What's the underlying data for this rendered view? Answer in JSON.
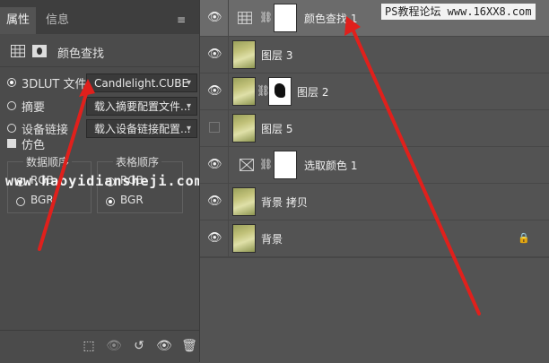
{
  "properties": {
    "tabs": [
      "属性",
      "信息"
    ],
    "header_title": "颜色查找",
    "lut_label": "3DLUT 文件",
    "lut_value": "Candlelight.CUBE",
    "abstract_label": "摘要",
    "abstract_value": "载入摘要配置文件...",
    "device_link_label": "设备链接",
    "device_link_value": "载入设备链接配置...",
    "dither_label": "仿色",
    "data_order": {
      "title": "数据顺序",
      "options": [
        "RGB",
        "BGR"
      ],
      "selected": "RGB"
    },
    "table_order": {
      "title": "表格顺序",
      "options": [
        "RGB",
        "BGR"
      ],
      "selected": "BGR"
    },
    "watermark": "www.haoyidiansheji.com"
  },
  "layers_panel": {
    "watermark": "PS教程论坛 www.16XX8.com",
    "layers": [
      {
        "name": "颜色查找 1",
        "kind": "adjustment-mask",
        "visible": true,
        "selected": true
      },
      {
        "name": "图层 3",
        "kind": "photo",
        "visible": true
      },
      {
        "name": "图层 2",
        "kind": "photo-mask",
        "visible": true
      },
      {
        "name": "图层 5",
        "kind": "photo",
        "visible": false
      },
      {
        "name": "选取颜色 1",
        "kind": "adjustment-mask",
        "visible": true
      },
      {
        "name": "背景 拷贝",
        "kind": "photo",
        "visible": true
      },
      {
        "name": "背景",
        "kind": "photo",
        "visible": true,
        "locked": true
      }
    ]
  },
  "colors": {
    "annotation_arrow": "#e0201c",
    "panel_bg": "#535353"
  }
}
